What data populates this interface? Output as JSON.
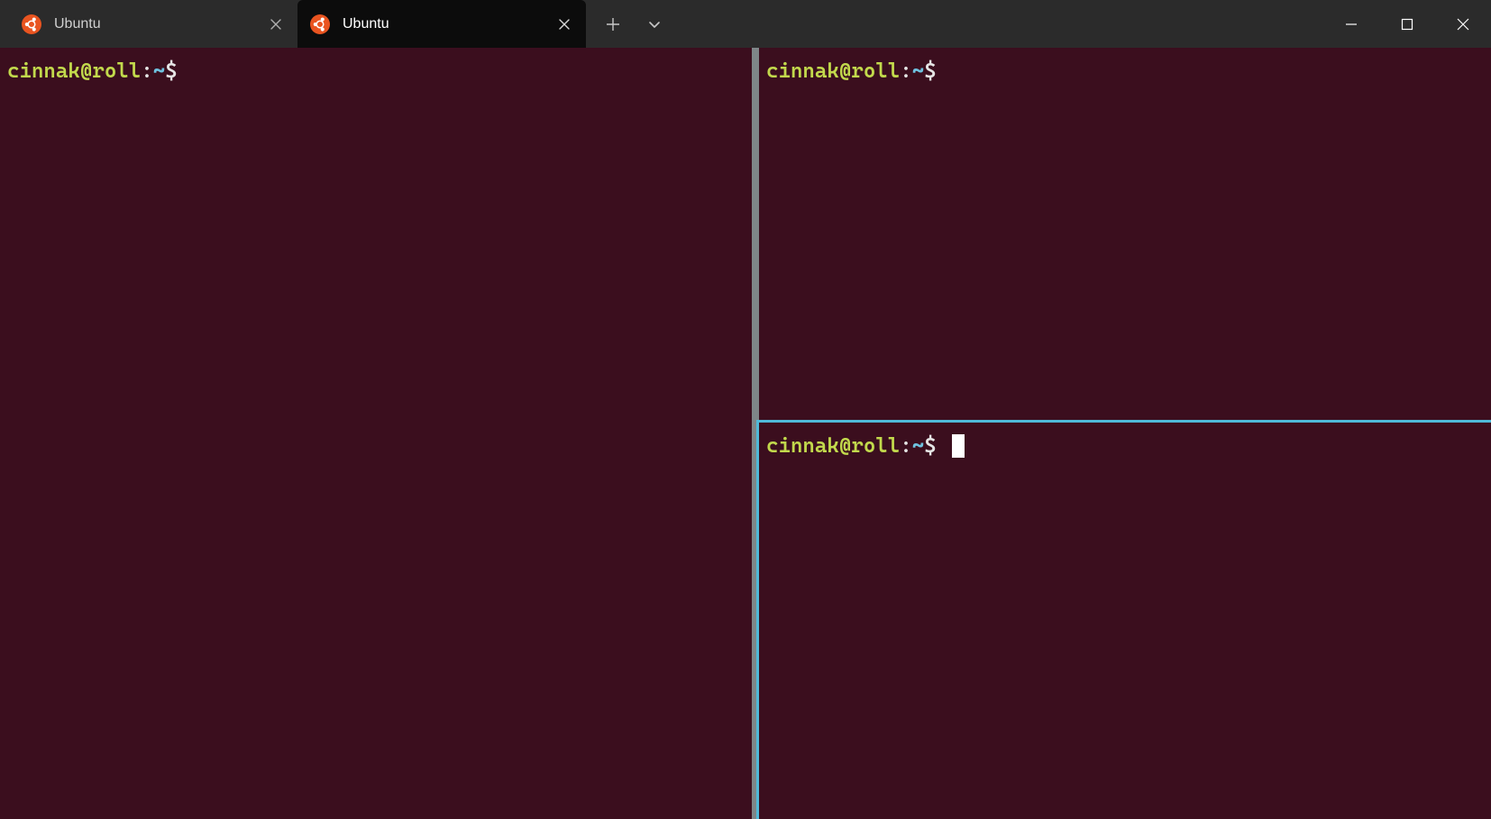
{
  "tabs": [
    {
      "title": "Ubuntu",
      "active": false
    },
    {
      "title": "Ubuntu",
      "active": true
    }
  ],
  "panes": {
    "left": {
      "user_host": "cinnak@roll",
      "colon": ":",
      "path": "~",
      "symbol": "$",
      "has_cursor": false
    },
    "right_top": {
      "user_host": "cinnak@roll",
      "colon": ":",
      "path": "~",
      "symbol": "$",
      "has_cursor": false
    },
    "right_bottom": {
      "user_host": "cinnak@roll",
      "colon": ":",
      "path": "~",
      "symbol": "$",
      "has_cursor": true
    }
  }
}
